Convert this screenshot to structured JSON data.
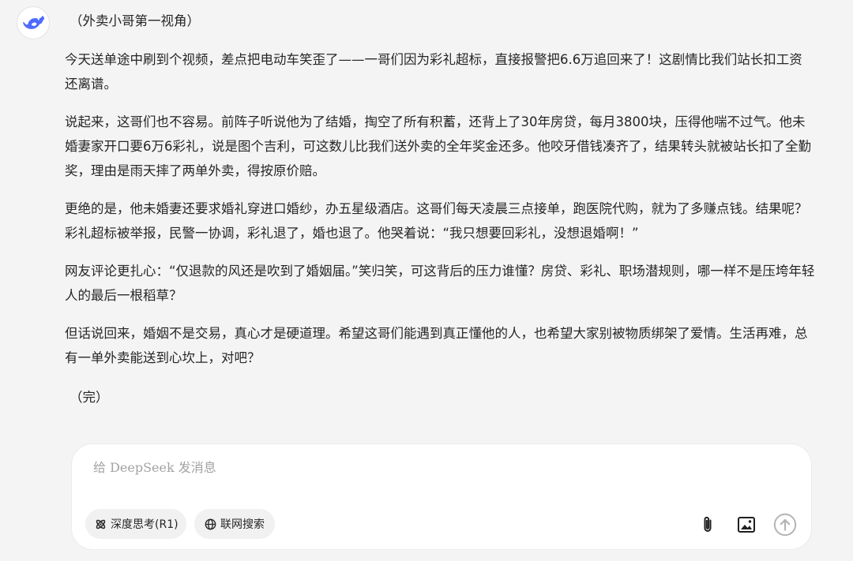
{
  "chat": {
    "message": {
      "intro": "（外卖小哥第一视角）",
      "paragraphs": [
        "今天送单途中刷到个视频，差点把电动车笑歪了——一哥们因为彩礼超标，直接报警把6.6万追回来了！这剧情比我们站长扣工资还离谱。",
        "说起来，这哥们也不容易。前阵子听说他为了结婚，掏空了所有积蓄，还背上了30年房贷，每月3800块，压得他喘不过气。他未婚妻家开口要6万6彩礼，说是图个吉利，可这数儿比我们送外卖的全年奖金还多。他咬牙借钱凑齐了，结果转头就被站长扣了全勤奖，理由是雨天摔了两单外卖，得按原价赔。",
        "更绝的是，他未婚妻还要求婚礼穿进口婚纱，办五星级酒店。这哥们每天凌晨三点接单，跑医院代购，就为了多赚点钱。结果呢？彩礼超标被举报，民警一协调，彩礼退了，婚也退了。他哭着说：“我只想要回彩礼，没想退婚啊！”",
        "网友评论更扎心：“仅退款的风还是吹到了婚姻届。”笑归笑，可这背后的压力谁懂？房贷、彩礼、职场潜规则，哪一样不是压垮年轻人的最后一根稻草？",
        "但话说回来，婚姻不是交易，真心才是硬道理。希望这哥们能遇到真正懂他的人，也希望大家别被物质绑架了爱情。生活再难，总有一单外卖能送到心坎上，对吧？"
      ],
      "outro": "（完）"
    }
  },
  "composer": {
    "placeholder": "给 DeepSeek 发消息",
    "value": "",
    "deep_think_label": "深度思考(R1)",
    "web_search_label": "联网搜索"
  },
  "icons": {
    "avatar": "deepseek-whale-logo",
    "deep_think": "atom-icon",
    "web_search": "globe-icon",
    "attach": "paperclip-icon",
    "image": "image-icon",
    "send": "arrow-up-icon"
  },
  "colors": {
    "brand": "#4d6bfe",
    "background": "#f4f4f4",
    "text": "#262626",
    "placeholder": "#a3a3a3",
    "send_disabled": "#b4b4b4"
  }
}
